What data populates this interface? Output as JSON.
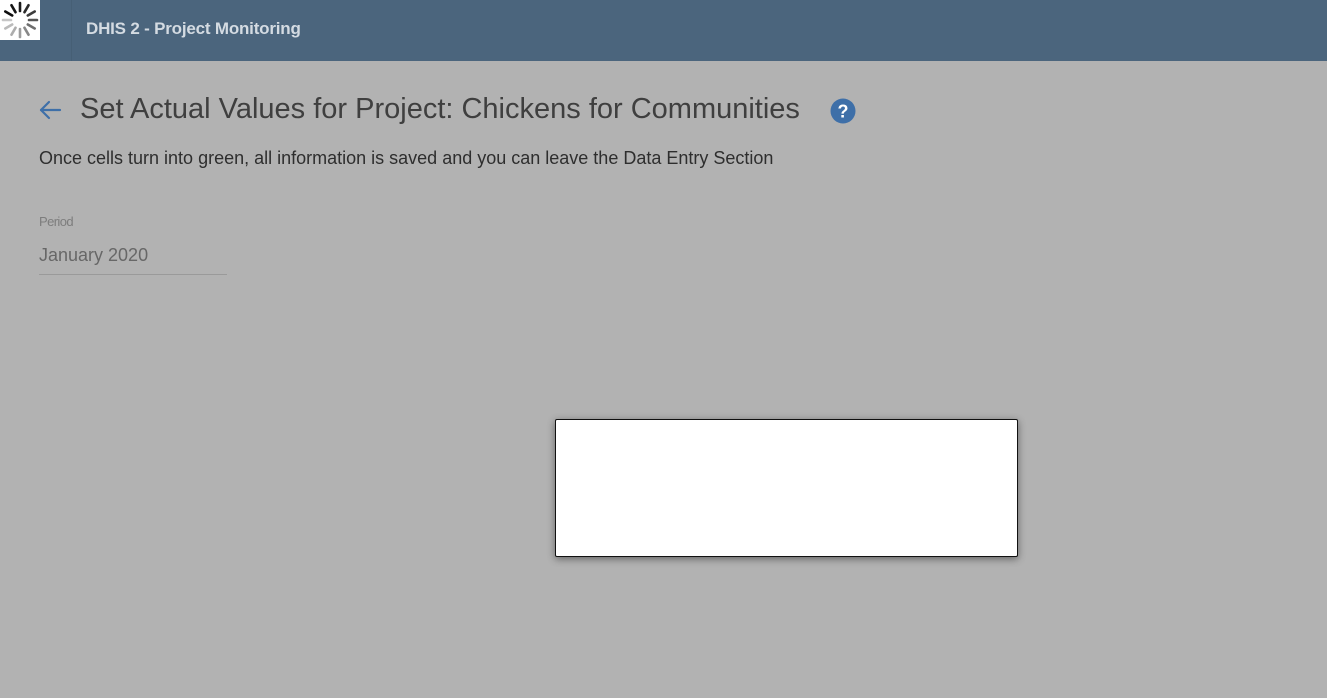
{
  "header": {
    "app_title": "DHIS 2 - Project Monitoring",
    "background_color": "#4b657d",
    "loading_icon": "spinner-icon"
  },
  "main": {
    "back_icon": "arrow-left-icon",
    "title": "Set Actual Values for Project: Chickens for Communities",
    "help_icon": "question-circle-icon",
    "instructions": "Once cells turn into green, all information is saved and you can leave the Data Entry Section",
    "period": {
      "label": "Period",
      "value": "January 2020"
    }
  },
  "colors": {
    "accent": "#3e6fa8",
    "overlay_background": "#b2b2b2"
  }
}
